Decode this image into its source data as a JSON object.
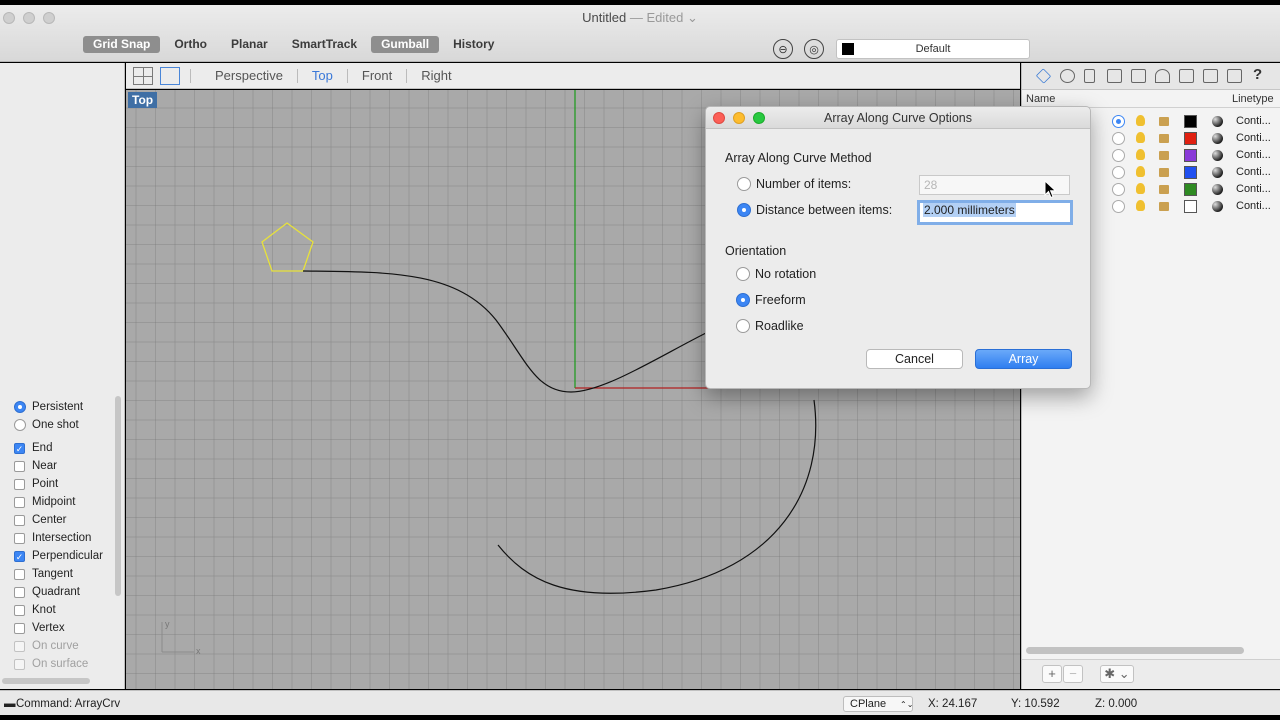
{
  "window": {
    "title": "Untitled",
    "status": "— Edited",
    "status_chevron": "⌄"
  },
  "toolbar": {
    "toggles": [
      {
        "label": "Grid Snap",
        "on": true
      },
      {
        "label": "Ortho",
        "on": false
      },
      {
        "label": "Planar",
        "on": false
      },
      {
        "label": "SmartTrack",
        "on": false
      },
      {
        "label": "Gumball",
        "on": true
      },
      {
        "label": "History",
        "on": false
      }
    ],
    "layer_name": "Default",
    "layer_color": "#000000"
  },
  "viewport_tabs": [
    {
      "label": "Perspective",
      "active": false
    },
    {
      "label": "Top",
      "active": true
    },
    {
      "label": "Front",
      "active": false
    },
    {
      "label": "Right",
      "active": false
    }
  ],
  "viewport": {
    "label": "Top",
    "axis_y": "y",
    "axis_x": "x",
    "curve_color": "#111111",
    "polygon_color": "#e8e23a"
  },
  "osnap": {
    "mode": [
      {
        "label": "Persistent",
        "on": true
      },
      {
        "label": "One shot",
        "on": false
      }
    ],
    "items": [
      {
        "label": "End",
        "on": true,
        "disabled": false
      },
      {
        "label": "Near",
        "on": false,
        "disabled": false
      },
      {
        "label": "Point",
        "on": false,
        "disabled": false
      },
      {
        "label": "Midpoint",
        "on": false,
        "disabled": false
      },
      {
        "label": "Center",
        "on": false,
        "disabled": false
      },
      {
        "label": "Intersection",
        "on": false,
        "disabled": false
      },
      {
        "label": "Perpendicular",
        "on": true,
        "disabled": false
      },
      {
        "label": "Tangent",
        "on": false,
        "disabled": false
      },
      {
        "label": "Quadrant",
        "on": false,
        "disabled": false
      },
      {
        "label": "Knot",
        "on": false,
        "disabled": false
      },
      {
        "label": "Vertex",
        "on": false,
        "disabled": false
      },
      {
        "label": "On curve",
        "on": false,
        "disabled": true
      },
      {
        "label": "On surface",
        "on": false,
        "disabled": true
      }
    ]
  },
  "layers_panel": {
    "col_name": "Name",
    "col_linetype": "Linetype",
    "rows": [
      {
        "current": true,
        "color": "#000000",
        "linetype": "Conti..."
      },
      {
        "current": false,
        "color": "#e02010",
        "linetype": "Conti..."
      },
      {
        "current": false,
        "color": "#8a3ad8",
        "linetype": "Conti..."
      },
      {
        "current": false,
        "color": "#2050f0",
        "linetype": "Conti..."
      },
      {
        "current": false,
        "color": "#2e8a22",
        "linetype": "Conti..."
      },
      {
        "current": false,
        "color": "#ffffff",
        "linetype": "Conti..."
      }
    ],
    "add_label": "+",
    "remove_label": "−",
    "gear_label": "✱ ⌄"
  },
  "status": {
    "command": "Command: ArrayCrv",
    "cplane": "CPlane",
    "cplane_arrows": "⌃⌄",
    "x": "X: 24.167",
    "y": "Y: 10.592",
    "z": "Z: 0.000"
  },
  "dialog": {
    "title": "Array Along Curve Options",
    "method_heading": "Array Along Curve Method",
    "number_label": "Number of items:",
    "number_value": "28",
    "distance_label": "Distance between items:",
    "distance_value": "2.000 millimeters",
    "method_selected": "distance",
    "orientation_heading": "Orientation",
    "orientation_options": [
      {
        "label": "No rotation",
        "on": false
      },
      {
        "label": "Freeform",
        "on": true
      },
      {
        "label": "Roadlike",
        "on": false
      }
    ],
    "cancel_label": "Cancel",
    "ok_label": "Array"
  }
}
